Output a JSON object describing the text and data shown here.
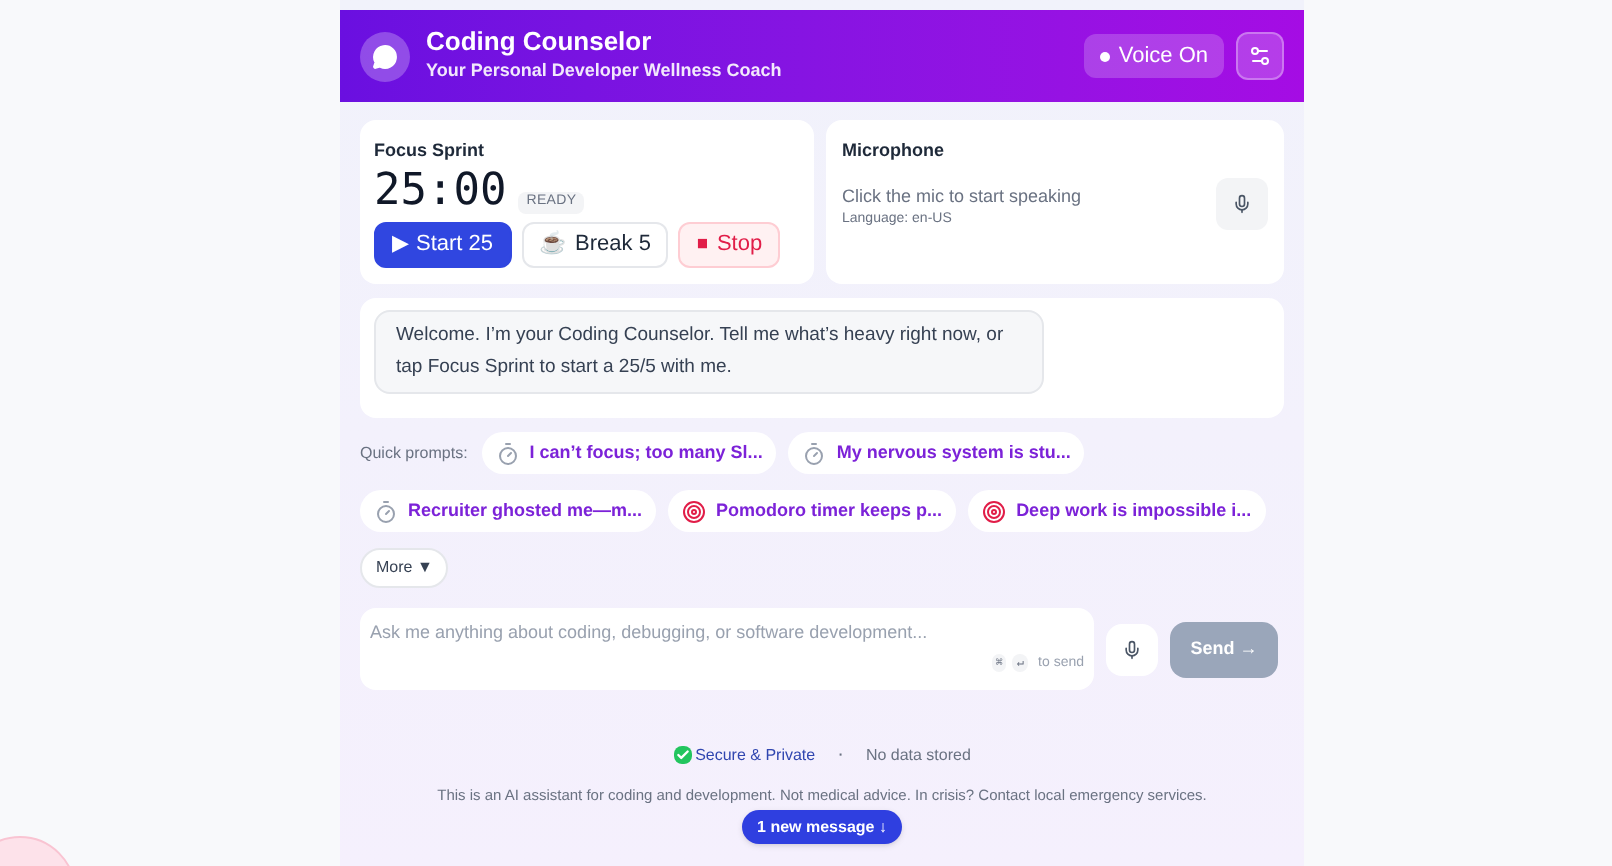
{
  "header": {
    "title": "Coding Counselor",
    "subtitle": "Your Personal Developer Wellness Coach",
    "voice": {
      "label": "Voice On",
      "on": true
    }
  },
  "focus_sprint": {
    "title": "Focus Sprint",
    "time": "25:00",
    "status": "READY",
    "buttons": [
      {
        "kind": "start",
        "icon": "▶",
        "label": "Start 25"
      },
      {
        "kind": "break",
        "icon": "☕",
        "label": "Break 5"
      },
      {
        "kind": "stop",
        "icon": "⏹",
        "label": "Stop"
      }
    ]
  },
  "microphone": {
    "title": "Microphone",
    "hint": "Click the mic to start speaking",
    "language": "Language: en-US"
  },
  "chat": {
    "messages": [
      "Welcome. I’m your Coding Counselor. Tell me what’s heavy right now, or tap Focus Sprint to start a 25/5 with me."
    ]
  },
  "quick_prompts": {
    "label": "Quick prompts:",
    "items": [
      {
        "kind": "timer",
        "label": "I can’t focus; too many Sl..."
      },
      {
        "kind": "timer",
        "label": "My nervous system is stu..."
      },
      {
        "kind": "timer",
        "label": "Recruiter ghosted me—m..."
      },
      {
        "kind": "target",
        "label": "Pomodoro timer keeps p..."
      },
      {
        "kind": "target",
        "label": "Deep work is impossible i..."
      }
    ],
    "more": "More ▼"
  },
  "composer": {
    "placeholder": "Ask me anything about coding, debugging, or software development...",
    "keys": [
      "⌘",
      "↵"
    ],
    "hint": "to send",
    "send": {
      "label": "Send →",
      "disabled": true
    }
  },
  "footer": {
    "secure": "Secure & Private",
    "separator": "·",
    "stored": "No data stored",
    "disclaimer": "This is an AI assistant for coding and development. Not medical advice. In crisis? Contact local emergency services.",
    "new_messages": "1 new message ↓"
  }
}
